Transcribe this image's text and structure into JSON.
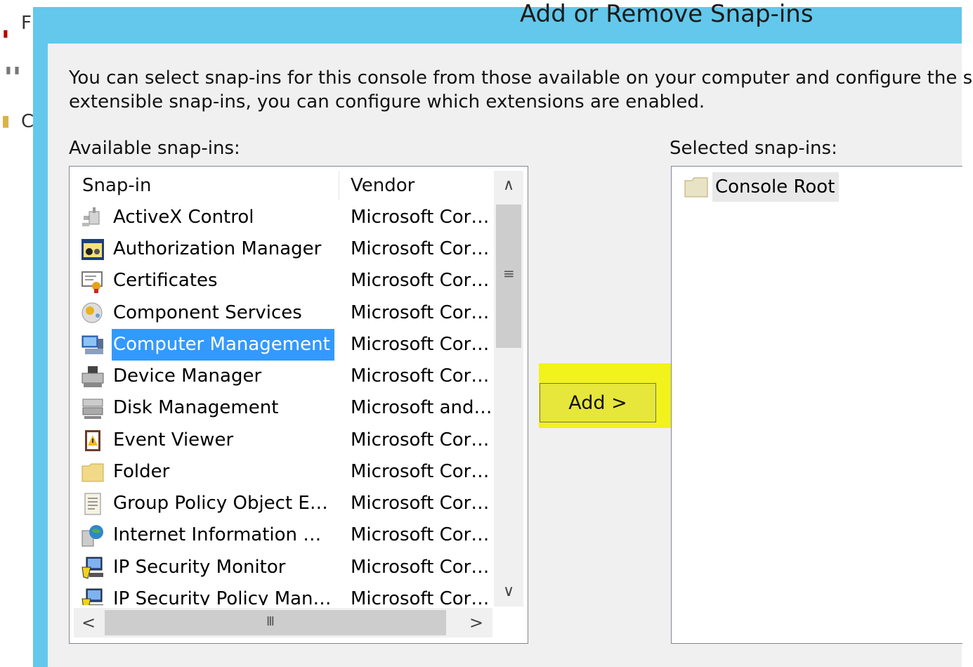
{
  "background": {
    "fragments": [
      "F",
      "C"
    ]
  },
  "dialog": {
    "title": "Add or Remove Snap-ins",
    "description_line1": "You can select snap-ins for this console from those available on your computer and configure the se",
    "description_line2": "extensible snap-ins, you can configure which extensions are enabled.",
    "accent_color": "#63c8ec"
  },
  "available": {
    "label": "Available snap-ins:",
    "columns": [
      "Snap-in",
      "Vendor"
    ],
    "rows": [
      {
        "name": "ActiveX Control",
        "vendor": "Microsoft Cor…",
        "icon": "activex-icon"
      },
      {
        "name": "Authorization Manager",
        "vendor": "Microsoft Cor…",
        "icon": "authorization-icon"
      },
      {
        "name": "Certificates",
        "vendor": "Microsoft Cor…",
        "icon": "certificate-icon"
      },
      {
        "name": "Component Services",
        "vendor": "Microsoft Cor…",
        "icon": "component-services-icon"
      },
      {
        "name": "Computer Management",
        "vendor": "Microsoft Cor…",
        "icon": "computer-management-icon",
        "selected": true
      },
      {
        "name": "Device Manager",
        "vendor": "Microsoft Cor…",
        "icon": "device-manager-icon"
      },
      {
        "name": "Disk Management",
        "vendor": "Microsoft and…",
        "icon": "disk-management-icon"
      },
      {
        "name": "Event Viewer",
        "vendor": "Microsoft Cor…",
        "icon": "event-viewer-icon"
      },
      {
        "name": "Folder",
        "vendor": "Microsoft Cor…",
        "icon": "folder-icon"
      },
      {
        "name": "Group Policy Object E…",
        "vendor": "Microsoft Cor…",
        "icon": "group-policy-icon"
      },
      {
        "name": "Internet Information …",
        "vendor": "Microsoft Cor…",
        "icon": "iis-icon"
      },
      {
        "name": "IP Security Monitor",
        "vendor": "Microsoft Cor…",
        "icon": "ip-security-icon"
      },
      {
        "name": "IP Security Policy Man…",
        "vendor": "Microsoft Cor…",
        "icon": "ip-security-policy-icon"
      }
    ],
    "scroll_glyphs": {
      "up": "∧",
      "down": "∨",
      "left": "<",
      "right": ">",
      "vgrip": "≡",
      "hgrip": "III"
    }
  },
  "actions": {
    "add_label": "Add >",
    "highlight_color": "#f2f21c"
  },
  "selected": {
    "label": "Selected snap-ins:",
    "items": [
      {
        "name": "Console Root",
        "icon": "folder-icon"
      }
    ]
  }
}
